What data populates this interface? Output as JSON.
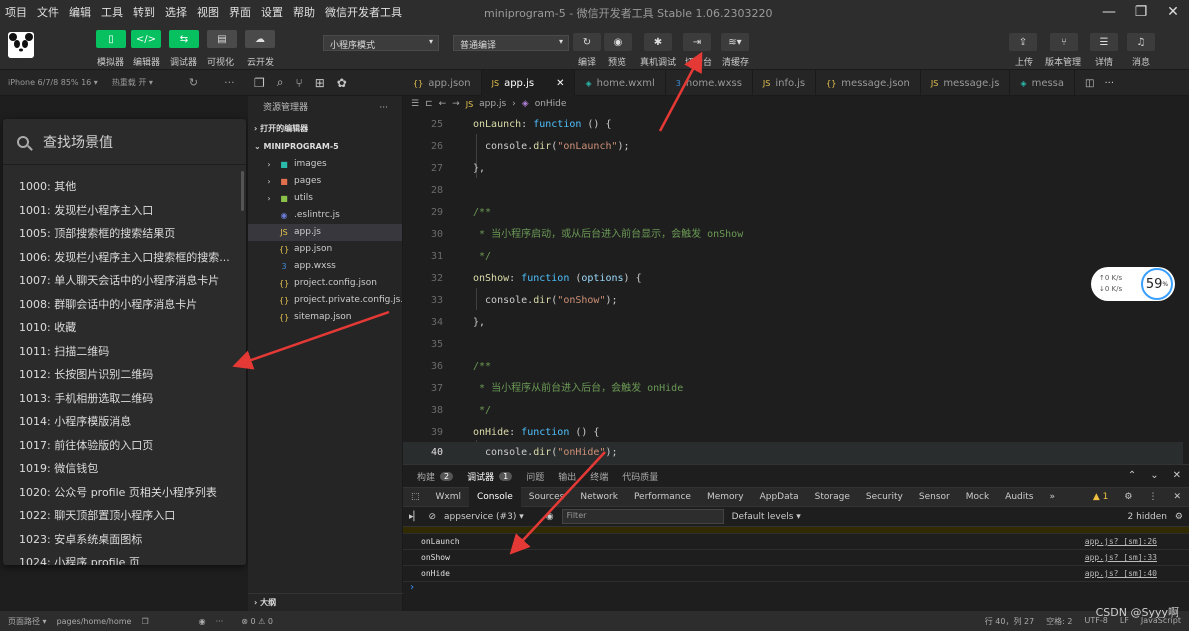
{
  "menu": [
    "项目",
    "文件",
    "编辑",
    "工具",
    "转到",
    "选择",
    "视图",
    "界面",
    "设置",
    "帮助",
    "微信开发者工具"
  ],
  "window_title": "miniprogram-5 - 微信开发者工具 Stable 1.06.2303220",
  "toolbar": {
    "simulator": "模拟器",
    "editor": "编辑器",
    "debugger": "调试器",
    "visual": "可视化",
    "cloud": "云开发",
    "mode_select": "小程序模式",
    "compile_select": "普通编译",
    "compile": "编译",
    "preview": "预览",
    "real_debug": "真机调试",
    "background": "切后台",
    "clear_cache": "清缓存",
    "upload": "上传",
    "version": "版本管理",
    "details": "详情",
    "messages": "消息"
  },
  "simbar": {
    "device": "iPhone 6/7/8 85% 16 ▾",
    "hotreload": "热重载 开 ▾"
  },
  "scene_panel": {
    "search_placeholder": "查找场景值",
    "items": [
      "1000: 其他",
      "1001: 发现栏小程序主入口",
      "1005: 顶部搜索框的搜索结果页",
      "1006: 发现栏小程序主入口搜索框的搜索...",
      "1007: 单人聊天会话中的小程序消息卡片",
      "1008: 群聊会话中的小程序消息卡片",
      "1010: 收藏",
      "1011: 扫描二维码",
      "1012: 长按图片识别二维码",
      "1013: 手机相册选取二维码",
      "1014: 小程序模版消息",
      "1017: 前往体验版的入口页",
      "1019: 微信钱包",
      "1020: 公众号 profile 页相关小程序列表",
      "1022: 聊天顶部置顶小程序入口",
      "1023: 安卓系统桌面图标",
      "1024: 小程序 profile 页"
    ]
  },
  "explorer": {
    "title": "资源管理器",
    "open_editors": "打开的编辑器",
    "project": "MINIPROGRAM-5",
    "bottom": "大纲",
    "items": [
      {
        "name": "images",
        "type": "folder"
      },
      {
        "name": "pages",
        "type": "folder"
      },
      {
        "name": "utils",
        "type": "folder"
      },
      {
        "name": ".eslintrc.js",
        "type": "eslint"
      },
      {
        "name": "app.js",
        "type": "js"
      },
      {
        "name": "app.json",
        "type": "json"
      },
      {
        "name": "app.wxss",
        "type": "css"
      },
      {
        "name": "project.config.json",
        "type": "json"
      },
      {
        "name": "project.private.config.js...",
        "type": "json"
      },
      {
        "name": "sitemap.json",
        "type": "json"
      }
    ]
  },
  "tabs": [
    "app.json",
    "app.js",
    "home.wxml",
    "home.wxss",
    "info.js",
    "message.json",
    "message.js",
    "messa"
  ],
  "breadcrumb": {
    "file": "app.js",
    "symbol": "onHide"
  },
  "code": {
    "line_numbers": [
      "25",
      "26",
      "27",
      "28",
      "29",
      "30",
      "31",
      "32",
      "33",
      "34",
      "35",
      "36",
      "37",
      "38",
      "39",
      "40"
    ],
    "line_25": "onLaunch",
    "line_26_arg": "\"onLaunch\"",
    "line_30": "* 当小程序启动，或从后台进入前台显示，会触发 onShow",
    "line_32": "onShow",
    "line_32_param": "options",
    "line_33_arg": "\"onShow\"",
    "line_37": "* 当小程序从前台进入后台，会触发 onHide",
    "line_39": "onHide",
    "line_40_arg": "\"onHide\""
  },
  "meter": {
    "up": "↑0  K/s",
    "down": "↓0  K/s",
    "value": "59",
    "unit": "%"
  },
  "panel": {
    "tabs": [
      {
        "label": "构建",
        "count": "2"
      },
      {
        "label": "调试器",
        "count": "1"
      },
      {
        "label": "问题",
        "count": ""
      },
      {
        "label": "输出",
        "count": ""
      },
      {
        "label": "终端",
        "count": ""
      },
      {
        "label": "代码质量",
        "count": ""
      }
    ],
    "devtools": [
      "Wxml",
      "Console",
      "Sources",
      "Network",
      "Performance",
      "Memory",
      "AppData",
      "Storage",
      "Security",
      "Sensor",
      "Mock",
      "Audits",
      "»"
    ],
    "warn_count": "1",
    "context": "appservice (#3)",
    "filter_placeholder": "Filter",
    "levels": "Default levels ▾",
    "hidden": "2 hidden",
    "logs": [
      {
        "msg": "onLaunch",
        "src": "app.js? [sm]:26"
      },
      {
        "msg": "onShow",
        "src": "app.js? [sm]:33"
      },
      {
        "msg": "onHide",
        "src": "app.js? [sm]:40"
      }
    ]
  },
  "status": {
    "path_label": "页面路径 ▾",
    "path": "pages/home/home",
    "errors": "⊗ 0 ⚠ 0",
    "position": "行 40，列 27",
    "spaces": "空格: 2",
    "encoding": "UTF-8",
    "eol": "LF",
    "lang": "JavaScript"
  },
  "watermark": "CSDN @Syyy啊",
  "colors": {
    "accent_green": "#07c160",
    "arrow_red": "#e53935",
    "link_blue": "#3794ff"
  }
}
